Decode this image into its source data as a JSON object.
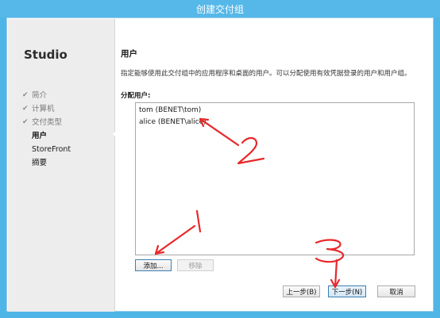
{
  "window": {
    "title": "创建交付组"
  },
  "sidebar": {
    "brand": "Studio",
    "steps": [
      {
        "label": "简介",
        "done": true
      },
      {
        "label": "计算机",
        "done": true
      },
      {
        "label": "交付类型",
        "done": true
      },
      {
        "label": "用户",
        "current": true
      },
      {
        "label": "StoreFront"
      },
      {
        "label": "摘要"
      }
    ]
  },
  "main": {
    "heading": "用户",
    "description": "指定能够使用此交付组中的应用程序和桌面的用户。可以分配使用有效凭据登录的用户和用户组。",
    "assigned_label": "分配用户:",
    "users": [
      "tom (BENET\\tom)",
      "alice (BENET\\alice)"
    ],
    "add_button": "添加...",
    "remove_button": "移除"
  },
  "footer": {
    "back_button": "上一步(B)",
    "next_button": "下一步(N)",
    "cancel_button": "取消"
  },
  "annotations": {
    "color": "#e8282b",
    "marks": [
      "1",
      "2",
      "3"
    ]
  }
}
